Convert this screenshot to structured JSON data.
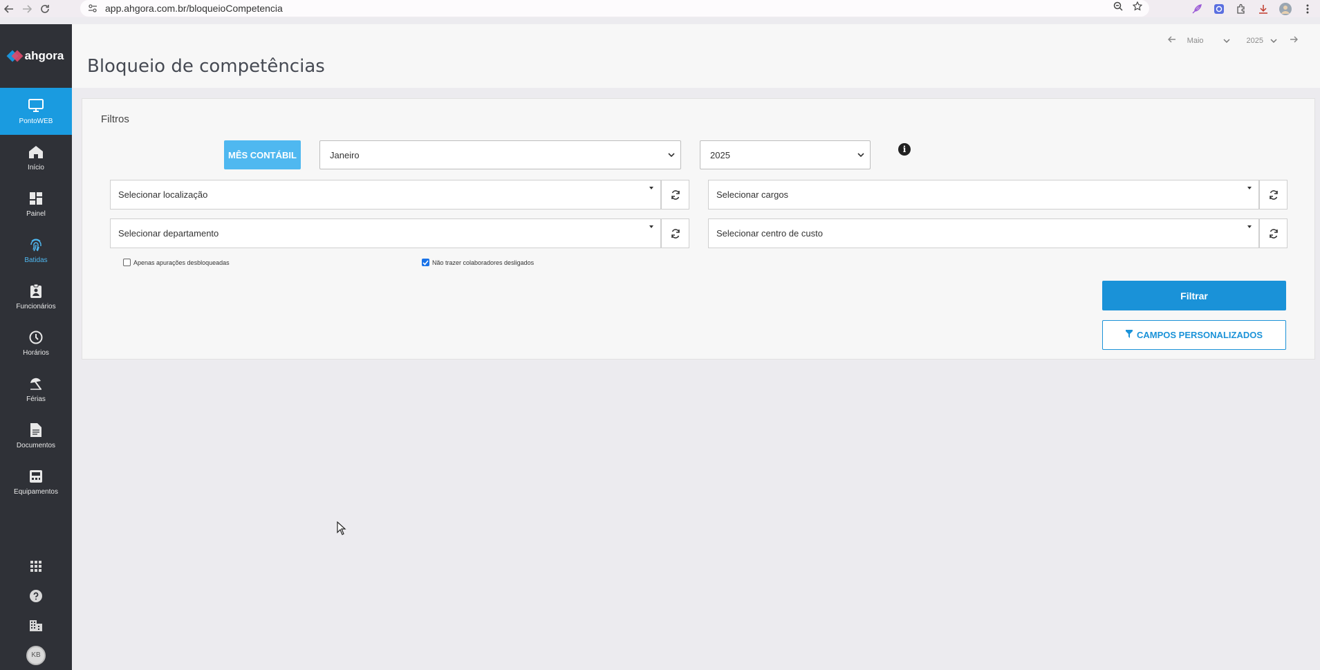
{
  "browser": {
    "url": "app.ahgora.com.br/bloqueioCompetencia"
  },
  "sidebar": {
    "brand": "ahgora",
    "app_item": {
      "label": "PontoWEB",
      "icon": "monitor-icon"
    },
    "items": [
      {
        "label": "Início",
        "icon": "home-icon"
      },
      {
        "label": "Painel",
        "icon": "dashboard-icon"
      },
      {
        "label": "Batidas",
        "icon": "fingerprint-icon"
      },
      {
        "label": "Funcionários",
        "icon": "badge-icon"
      },
      {
        "label": "Horários",
        "icon": "clock-icon"
      },
      {
        "label": "Férias",
        "icon": "umbrella-icon"
      },
      {
        "label": "Documentos",
        "icon": "document-icon"
      },
      {
        "label": "Equipamentos",
        "icon": "device-icon"
      }
    ],
    "avatar_initials": "KB"
  },
  "header": {
    "title": "Bloqueio de competências",
    "period": {
      "month": "Maio",
      "year": "2025"
    }
  },
  "filters": {
    "title": "Filtros",
    "mes_button": "MÊS CONTÁBIL",
    "month_value": "Janeiro",
    "year_value": "2025",
    "localizacao_placeholder": "Selecionar localização",
    "cargos_placeholder": "Selecionar cargos",
    "departamento_placeholder": "Selecionar departamento",
    "centro_custo_placeholder": "Selecionar centro de custo",
    "checkbox_desbloqueadas": {
      "label": "Apenas apurações desbloqueadas",
      "checked": false
    },
    "checkbox_desligados": {
      "label": "Não trazer colaboradores desligados",
      "checked": true
    },
    "filtrar_button": "Filtrar",
    "campos_button": "CAMPOS PERSONALIZADOS"
  },
  "colors": {
    "accent": "#1a92d8",
    "accent_light": "#4fb8f0",
    "sidebar_bg": "#2f3137"
  }
}
